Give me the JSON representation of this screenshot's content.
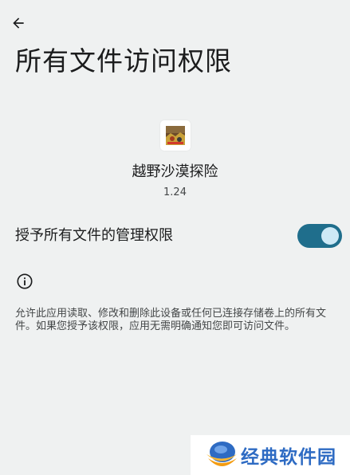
{
  "header": {
    "back_icon": "arrow-back-icon",
    "title": "所有文件访问权限"
  },
  "app": {
    "icon": "app-icon",
    "name": "越野沙漠探险",
    "version": "1.24"
  },
  "permission": {
    "label": "授予所有文件的管理权限",
    "enabled": true
  },
  "info": {
    "icon": "info-icon",
    "description": "允许此应用读取、修改和删除此设备或任何已连接存储卷上的所有文件。如果您授予该权限，应用无需明确通知您即可访问文件。"
  },
  "watermark": {
    "text": "经典软件园"
  },
  "colors": {
    "background": "#eff1f1",
    "toggle_track": "#1f6e8c",
    "toggle_thumb": "#cde9f6",
    "watermark_text": "#2e6bc3",
    "watermark_logo": "#f39c12"
  }
}
